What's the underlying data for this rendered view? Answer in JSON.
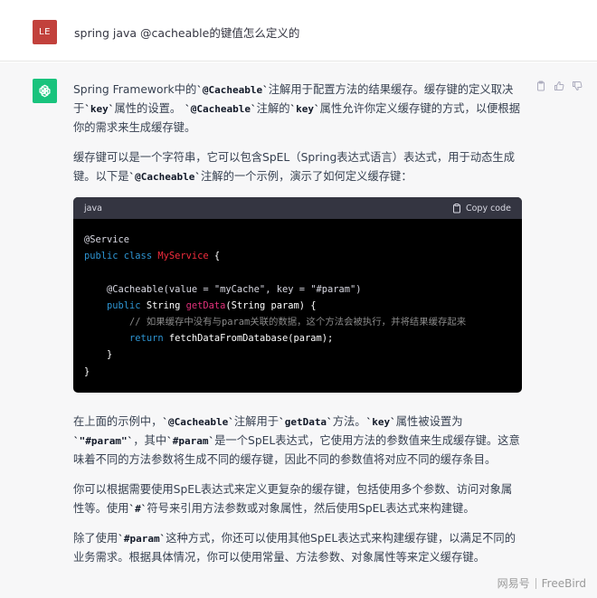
{
  "user": {
    "avatar_initials": "LE",
    "message": "spring java @cacheable的键值怎么定义的"
  },
  "assistant": {
    "p1": {
      "a": "Spring Framework中的",
      "c1": "`@Cacheable`",
      "b": "注解用于配置方法的结果缓存。缓存键的定义取决于",
      "c2": "`key`",
      "d": "属性的设置。",
      "c3": "`@Cacheable`",
      "e": "注解的",
      "c4": "`key`",
      "f": "属性允许你定义缓存键的方式，以便根据你的需求来生成缓存键。"
    },
    "p2": {
      "a": "缓存键可以是一个字符串，它可以包含SpEL（Spring表达式语言）表达式，用于动态生成键。以下是",
      "c1": "`@Cacheable`",
      "b": "注解的一个示例，演示了如何定义缓存键："
    },
    "code": {
      "lang": "java",
      "copy_label": "Copy code",
      "l1": "@Service",
      "l2_kw": "public class",
      "l2_cls": "MyService",
      "l2_rest": " {",
      "l4": "@Cacheable(value = \"myCache\", key = \"#param\")",
      "l5_kw": "public",
      "l5_type": " String ",
      "l5_fn": "getData",
      "l5_rest": "(String param) {",
      "l6": "// 如果缓存中没有与param关联的数据，这个方法会被执行，并将结果缓存起来",
      "l7_kw": "return",
      "l7_rest": " fetchDataFromDatabase(param);",
      "l8": "}",
      "l9": "}"
    },
    "p3": {
      "a": "在上面的示例中，",
      "c1": "`@Cacheable`",
      "b": "注解用于",
      "c2": "`getData`",
      "c": "方法。",
      "c3": "`key`",
      "d": "属性被设置为",
      "c4": "`\"#param\"`",
      "e": "，其中",
      "c5": "`#param`",
      "f": "是一个SpEL表达式，它使用方法的参数值来生成缓存键。这意味着不同的方法参数将生成不同的缓存键，因此不同的参数值将对应不同的缓存条目。"
    },
    "p4": {
      "a": "你可以根据需要使用SpEL表达式来定义更复杂的缓存键，包括使用多个参数、访问对象属性等。使用",
      "c1": "`#`",
      "b": "符号来引用方法参数或对象属性，然后使用SpEL表达式来构建键。"
    },
    "p5": {
      "a": "除了使用",
      "c1": "`#param`",
      "b": "这种方式，你还可以使用其他SpEL表达式来构建缓存键，以满足不同的业务需求。根据具体情况，你可以使用常量、方法参数、对象属性等来定义缓存键。"
    }
  },
  "watermark": {
    "left": "网易号",
    "right": "FreeBird"
  }
}
